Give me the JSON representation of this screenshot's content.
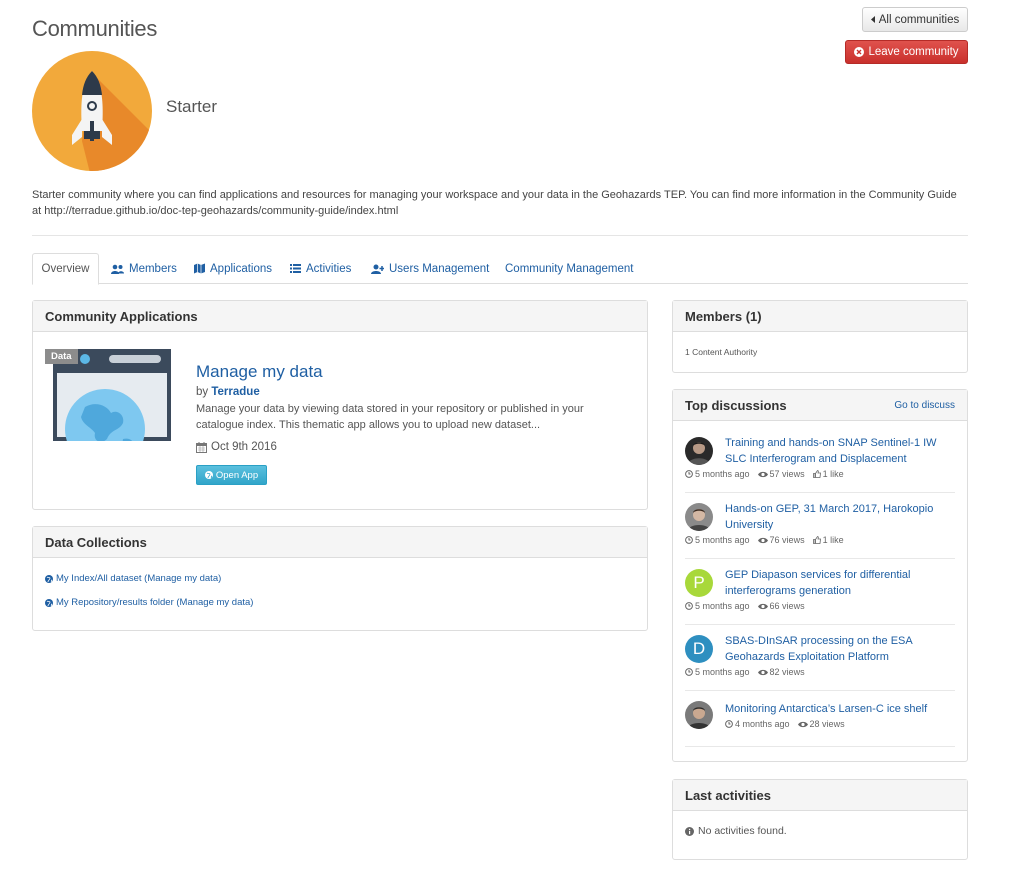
{
  "header": {
    "title": "Communities",
    "all_communities_label": "All communities",
    "leave_label": "Leave community"
  },
  "community": {
    "name": "Starter",
    "description": "Starter community where you can find applications and resources for managing your workspace and your data in the Geohazards TEP. You can find more information in the Community Guide at http://terradue.github.io/doc-tep-geohazards/community-guide/index.html"
  },
  "tabs": [
    {
      "label": "Overview",
      "icon": "none"
    },
    {
      "label": "Members",
      "icon": "users-icon"
    },
    {
      "label": "Applications",
      "icon": "map-icon"
    },
    {
      "label": "Activities",
      "icon": "list-icon"
    },
    {
      "label": "Users Management",
      "icon": "user-plus-icon"
    },
    {
      "label": "Community Management",
      "icon": "none"
    }
  ],
  "applications_panel": {
    "title": "Community Applications",
    "app": {
      "badge": "Data",
      "title": "Manage my data",
      "by_prefix": "by",
      "author": "Terradue",
      "description": "Manage your data by viewing data stored in your repository or published in your catalogue index. This thematic app allows you to upload new dataset...",
      "date": "Oct 9th 2016",
      "open_label": "Open App"
    }
  },
  "data_collections": {
    "title": "Data Collections",
    "items": [
      "My Index/All dataset (Manage my data)",
      "My Repository/results folder (Manage my data)"
    ]
  },
  "members_panel": {
    "title": "Members (1)",
    "text": "1 Content Authority"
  },
  "discussions": {
    "title": "Top discussions",
    "go_link": "Go to discuss",
    "items": [
      {
        "title": "Training and hands-on SNAP Sentinel-1 IW SLC Interferogram and Displacement",
        "time": "5 months ago",
        "views": "57 views",
        "likes": "1 like",
        "avatar": "photo"
      },
      {
        "title": "Hands-on GEP, 31 March 2017, Harokopio University",
        "time": "5 months ago",
        "views": "76 views",
        "likes": "1 like",
        "avatar": "photo"
      },
      {
        "title": "GEP Diapason services for differential interferograms generation",
        "time": "5 months ago",
        "views": "66 views",
        "likes": "",
        "avatar": "P"
      },
      {
        "title": "SBAS-DInSAR processing on the ESA Geohazards Exploitation Platform",
        "time": "5 months ago",
        "views": "82 views",
        "likes": "",
        "avatar": "D"
      },
      {
        "title": "Monitoring Antarctica’s Larsen-C ice shelf",
        "time": "4 months ago",
        "views": "28 views",
        "likes": "",
        "avatar": "photo"
      }
    ]
  },
  "activities": {
    "title": "Last activities",
    "empty": "No activities found."
  },
  "colors": {
    "link": "#1f5fa3",
    "danger": "#d9534f",
    "info": "#5bc0de",
    "logo_orange": "#f2a93b",
    "avatar_p": "#a8d83a",
    "avatar_d": "#2e8fc0"
  }
}
